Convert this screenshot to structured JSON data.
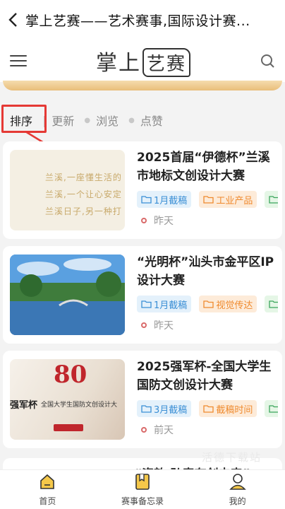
{
  "topbar": {
    "title": "掌上艺赛——艺术赛事,国际设计赛..."
  },
  "header": {
    "logo_a": "掌上",
    "logo_b": "艺赛"
  },
  "sort": {
    "items": [
      "排序",
      "更新",
      "浏览",
      "点赞"
    ]
  },
  "cards": [
    {
      "title": "2025首届“伊德杯”兰溪市地标文创设计大赛",
      "tags": [
        "1月截稿",
        "工业产品",
        ""
      ],
      "time": "昨天",
      "thumb_lines": [
        "兰溪,一座懂生活的",
        "兰溪,一个让心安定",
        "兰溪日子,另一种打"
      ]
    },
    {
      "title": "“光明杯”汕头市金平区IP设计大赛",
      "tags": [
        "1月截稿",
        "视觉传达",
        ""
      ],
      "time": "昨天"
    },
    {
      "title": "2025强军杯-全国大学生国防文创设计大赛",
      "tags": [
        "3月截稿",
        "截稿时间",
        ""
      ],
      "time": "前天",
      "thumb_text": {
        "big": "80",
        "left": "强军杯",
        "line": "全国大学生国防文创设计大"
      }
    }
  ],
  "peek": {
    "title": "“瓷韵·弘毒存创未来”"
  },
  "watermark": "活德下载站",
  "bottomnav": {
    "items": [
      "首页",
      "赛事备忘录",
      "我的"
    ]
  },
  "colors": {
    "accent": "#e53935",
    "gold": "#e9be7a",
    "tag_blue": "#3b8fd5",
    "tag_orange": "#ef8a2e",
    "tag_green": "#3ba55c"
  }
}
